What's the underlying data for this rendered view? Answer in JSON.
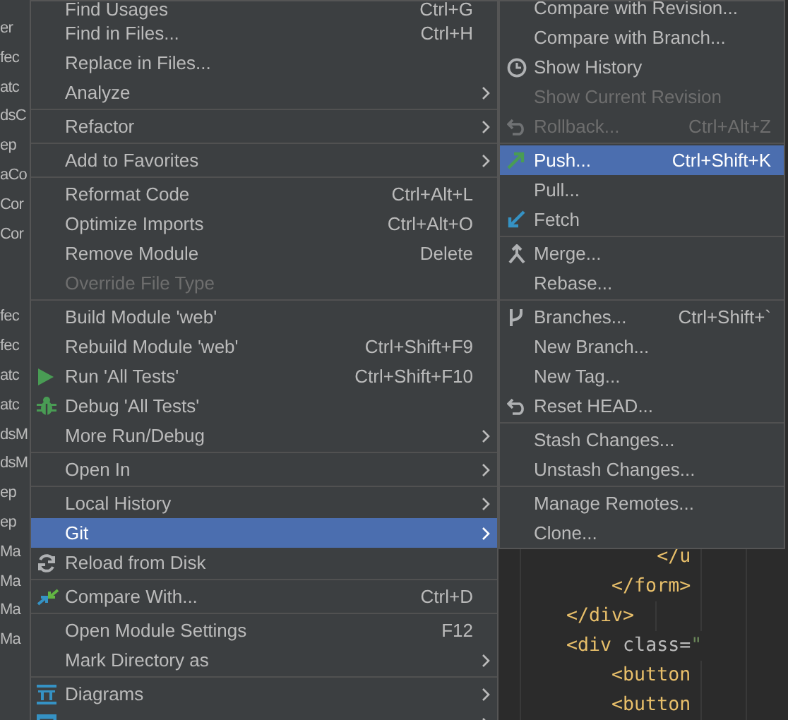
{
  "project_tree": {
    "groups": [
      {
        "items": [
          "er",
          "fec",
          "atc",
          "dsC",
          "ep",
          "aCo",
          "Cor",
          "Cor"
        ]
      },
      {
        "items": [
          "fec",
          "fec",
          "atc",
          "atc",
          "dsM",
          "dsM",
          "ep",
          "ep",
          "Ma",
          "Ma",
          "Ma",
          "Ma"
        ]
      }
    ]
  },
  "context_menu": {
    "items": [
      {
        "kind": "item",
        "label": "Find Usages",
        "shortcut": "Ctrl+G",
        "submenu": false,
        "disabled": false,
        "selected": false
      },
      {
        "kind": "item",
        "label": "Find in Files...",
        "shortcut": "Ctrl+H",
        "submenu": false,
        "disabled": false,
        "selected": false
      },
      {
        "kind": "item",
        "label": "Replace in Files...",
        "submenu": false,
        "disabled": false,
        "selected": false
      },
      {
        "kind": "item",
        "label": "Analyze",
        "submenu": true,
        "disabled": false,
        "selected": false
      },
      {
        "kind": "separator"
      },
      {
        "kind": "item",
        "label": "Refactor",
        "submenu": true,
        "disabled": false,
        "selected": false
      },
      {
        "kind": "separator"
      },
      {
        "kind": "item",
        "label": "Add to Favorites",
        "submenu": true,
        "disabled": false,
        "selected": false
      },
      {
        "kind": "separator"
      },
      {
        "kind": "item",
        "label": "Reformat Code",
        "shortcut": "Ctrl+Alt+L",
        "submenu": false,
        "disabled": false,
        "selected": false
      },
      {
        "kind": "item",
        "label": "Optimize Imports",
        "shortcut": "Ctrl+Alt+O",
        "submenu": false,
        "disabled": false,
        "selected": false
      },
      {
        "kind": "item",
        "label": "Remove Module",
        "shortcut": "Delete",
        "submenu": false,
        "disabled": false,
        "selected": false
      },
      {
        "kind": "item",
        "label": "Override File Type",
        "submenu": false,
        "disabled": true,
        "selected": false
      },
      {
        "kind": "separator"
      },
      {
        "kind": "item",
        "label": "Build Module 'web'",
        "submenu": false,
        "disabled": false,
        "selected": false
      },
      {
        "kind": "item",
        "label": "Rebuild Module 'web'",
        "shortcut": "Ctrl+Shift+F9",
        "submenu": false,
        "disabled": false,
        "selected": false
      },
      {
        "kind": "item",
        "label": "Run 'All Tests'",
        "shortcut": "Ctrl+Shift+F10",
        "submenu": false,
        "disabled": false,
        "selected": false
      },
      {
        "kind": "item",
        "label": "Debug 'All Tests'",
        "submenu": false,
        "disabled": false,
        "selected": false
      },
      {
        "kind": "item",
        "label": "More Run/Debug",
        "submenu": true,
        "disabled": false,
        "selected": false
      },
      {
        "kind": "separator"
      },
      {
        "kind": "item",
        "label": "Open In",
        "submenu": true,
        "disabled": false,
        "selected": false
      },
      {
        "kind": "separator"
      },
      {
        "kind": "item",
        "label": "Local History",
        "submenu": true,
        "disabled": false,
        "selected": false
      },
      {
        "kind": "item",
        "label": "Git",
        "submenu": true,
        "disabled": false,
        "selected": true
      },
      {
        "kind": "item",
        "label": "Reload from Disk",
        "submenu": false,
        "disabled": false,
        "selected": false
      },
      {
        "kind": "separator"
      },
      {
        "kind": "item",
        "label": "Compare With...",
        "shortcut": "Ctrl+D",
        "submenu": false,
        "disabled": false,
        "selected": false
      },
      {
        "kind": "separator"
      },
      {
        "kind": "item",
        "label": "Open Module Settings",
        "shortcut": "F12",
        "submenu": false,
        "disabled": false,
        "selected": false
      },
      {
        "kind": "item",
        "label": "Mark Directory as",
        "submenu": true,
        "disabled": false,
        "selected": false
      },
      {
        "kind": "separator"
      },
      {
        "kind": "item",
        "label": "Diagrams",
        "submenu": true,
        "disabled": false,
        "selected": false
      },
      {
        "kind": "item",
        "submenu": true,
        "disabled": false,
        "selected": false
      }
    ]
  },
  "git_submenu": {
    "items": [
      {
        "kind": "item",
        "label": "Compare with Revision...",
        "disabled": false,
        "selected": false
      },
      {
        "kind": "item",
        "label": "Compare with Branch...",
        "disabled": false,
        "selected": false
      },
      {
        "kind": "item",
        "label": "Show History",
        "disabled": false,
        "selected": false
      },
      {
        "kind": "item",
        "label": "Show Current Revision",
        "disabled": true,
        "selected": false
      },
      {
        "kind": "item",
        "label": "Rollback...",
        "shortcut": "Ctrl+Alt+Z",
        "disabled": true,
        "selected": false
      },
      {
        "kind": "separator"
      },
      {
        "kind": "item",
        "label": "Push...",
        "shortcut": "Ctrl+Shift+K",
        "disabled": false,
        "selected": true
      },
      {
        "kind": "item",
        "label": "Pull...",
        "disabled": false,
        "selected": false
      },
      {
        "kind": "item",
        "label": "Fetch",
        "disabled": false,
        "selected": false
      },
      {
        "kind": "separator"
      },
      {
        "kind": "item",
        "label": "Merge...",
        "disabled": false,
        "selected": false
      },
      {
        "kind": "item",
        "label": "Rebase...",
        "disabled": false,
        "selected": false
      },
      {
        "kind": "separator"
      },
      {
        "kind": "item",
        "label": "Branches...",
        "shortcut": "Ctrl+Shift+`",
        "disabled": false,
        "selected": false
      },
      {
        "kind": "item",
        "label": "New Branch...",
        "disabled": false,
        "selected": false
      },
      {
        "kind": "item",
        "label": "New Tag...",
        "disabled": false,
        "selected": false
      },
      {
        "kind": "item",
        "label": "Reset HEAD...",
        "disabled": false,
        "selected": false
      },
      {
        "kind": "separator"
      },
      {
        "kind": "item",
        "label": "Stash Changes...",
        "disabled": false,
        "selected": false
      },
      {
        "kind": "item",
        "label": "Unstash Changes...",
        "disabled": false,
        "selected": false
      },
      {
        "kind": "separator"
      },
      {
        "kind": "item",
        "label": "Manage Remotes...",
        "disabled": false,
        "selected": false
      },
      {
        "kind": "item",
        "label": "Clone...",
        "disabled": false,
        "selected": false
      }
    ]
  },
  "editor": {
    "lines": [
      {
        "tokens": [
          {
            "kind": "tag",
            "text": "            </u"
          }
        ]
      },
      {
        "tokens": [
          {
            "kind": "tag",
            "text": "        </form>"
          }
        ]
      },
      {
        "tokens": [
          {
            "kind": "tag",
            "text": "    </div>"
          }
        ]
      },
      {
        "tokens": [
          {
            "kind": "tag",
            "text": "    <div"
          },
          {
            "kind": "attr",
            "text": " class="
          },
          {
            "kind": "string",
            "text": "\""
          }
        ]
      },
      {
        "tokens": [
          {
            "kind": "tag",
            "text": "        <button"
          }
        ]
      },
      {
        "tokens": [
          {
            "kind": "tag",
            "text": "        <button"
          }
        ]
      }
    ]
  }
}
